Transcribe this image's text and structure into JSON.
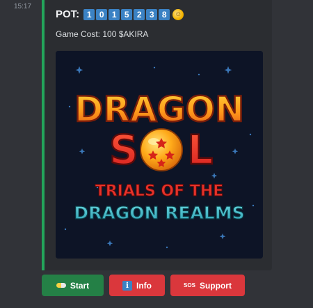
{
  "message": {
    "timestamp": "15:17"
  },
  "embed": {
    "pot_label": "POT:",
    "pot_digits": [
      "1",
      "0",
      "1",
      "5",
      "2",
      "3",
      "8"
    ],
    "game_cost": "Game Cost: 100 $AKIRA",
    "banner": {
      "line1": "DRAGON",
      "line2_left": "S",
      "line2_right": "L",
      "line3": "TRIALS OF THE",
      "line4": "DRAGON REALMS"
    }
  },
  "buttons": {
    "start": "Start",
    "info": "Info",
    "support": "Support",
    "sos_glyph": "SOS",
    "info_glyph": "i"
  },
  "colors": {
    "embed_accent": "#23a55a",
    "start_button": "#248046",
    "action_button": "#da373c"
  }
}
